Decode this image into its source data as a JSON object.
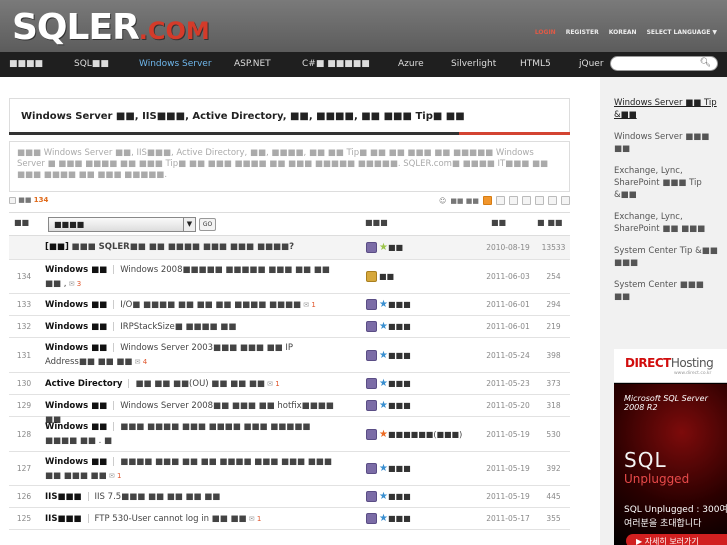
{
  "header": {
    "logo_main": "SQLER",
    "logo_suffix": ".COM",
    "links": [
      "LOGIN",
      "REGISTER",
      "KOREAN",
      "SELECT LANGUAGE ▼"
    ]
  },
  "nav": {
    "items": [
      "■■■■",
      "SQL■■",
      "Windows Server",
      "ASP.NET",
      "C#■ ■■■■■",
      "Azure",
      "Silverlight",
      "HTML5",
      "jQuer"
    ],
    "active_index": 2
  },
  "search": {
    "placeholder": ""
  },
  "page": {
    "title": "Windows Server ■■, IIS■■■, Active Directory, ■■, ■■■■, ■■ ■■■ Tip■ ■■",
    "description_1": "■■■ Windows Server ■■, IIS■■■, Active Directory, ■■, ■■■■, ■■ ■■ Tip■ ■■ ■■ ■■■ ■■ ■■■■■",
    "description_2": "Windows Server ■ ■■■ ■■■■ ■■ ■■■ Tip■ ■■ ■■■ ■■■■ ■■ ■■■ ■■■■■ ■■■■■. SQLER.com■ ■■■■",
    "description_3": "IT■■■ ■■ ■■■ ■■■■ ■■ ■■■ ■■■■■."
  },
  "toolbar": {
    "count_label": "■■",
    "count": "134",
    "user_label": "■■ ■■"
  },
  "table": {
    "headers": {
      "num": "■■",
      "author": "■■■",
      "date": "■■",
      "views": "■ ■■"
    },
    "category_select": "■■■■",
    "go_label": "GO",
    "rows": [
      {
        "num": "",
        "category": "[■■]",
        "text": "■■■ SQLER■■ ■■ ■■■■ ■■■ ■■■ ■■■■?",
        "comments": "",
        "author": "■■",
        "date": "2010-08-19",
        "views": "13533",
        "notice": true
      },
      {
        "num": "134",
        "category": "Windows ■■",
        "text": "Windows 2008■■■■■ ■■■■■ ■■■ ■■ ■■ ■■ ,",
        "comments": "3",
        "author": "■■",
        "date": "2011-06-03",
        "views": "254"
      },
      {
        "num": "133",
        "category": "Windows ■■",
        "text": "I/O■ ■■■■ ■■ ■■ ■■ ■■■■ ■■■■",
        "comments": "1",
        "author": "■■■",
        "date": "2011-06-01",
        "views": "294"
      },
      {
        "num": "132",
        "category": "Windows ■■",
        "text": "IRPStackSize■ ■■■■ ■■",
        "comments": "",
        "author": "■■■",
        "date": "2011-06-01",
        "views": "219"
      },
      {
        "num": "131",
        "category": "Windows ■■",
        "text": "Windows Server 2003■■■ ■■■ ■■ IP Address■■ ■■ ■■",
        "comments": "4",
        "author": "■■■",
        "date": "2011-05-24",
        "views": "398"
      },
      {
        "num": "130",
        "category": "Active Directory",
        "text": "■■ ■■ ■■(OU) ■■ ■■ ■■",
        "comments": "1",
        "author": "■■■",
        "date": "2011-05-23",
        "views": "373"
      },
      {
        "num": "129",
        "category": "Windows ■■",
        "text": "Windows Server 2008■■ ■■■ ■■ hotfix■■■■ ■■",
        "comments": "",
        "author": "■■■",
        "date": "2011-05-20",
        "views": "318"
      },
      {
        "num": "128",
        "category": "Windows ■■",
        "text": "■■■ ■■■■ ■■■ ■■■■ ■■■ ■■■■■ ■■■■ ■■ . ■",
        "comments": "",
        "author": "■■■■■■(■■■)",
        "date": "2011-05-19",
        "views": "530"
      },
      {
        "num": "127",
        "category": "Windows ■■",
        "text": "■■■■ ■■■ ■■ ■■ ■■■■ ■■■ ■■■ ■■■ ■■ ■■■ ■■",
        "comments": "1",
        "author": "■■■",
        "date": "2011-05-19",
        "views": "392"
      },
      {
        "num": "126",
        "category": "IIS■■■",
        "text": "IIS 7.5■■■ ■■ ■■ ■■ ■■",
        "comments": "",
        "author": "■■■",
        "date": "2011-05-19",
        "views": "445"
      },
      {
        "num": "125",
        "category": "IIS■■■",
        "text": "FTP 530-User cannot log in ■■ ■■",
        "comments": "1",
        "author": "■■■",
        "date": "2011-05-17",
        "views": "355"
      }
    ]
  },
  "sidebar": {
    "links": [
      "Windows Server ■■ Tip &■■",
      "Windows Server ■■■ ■■",
      "Exchange, Lync, SharePoint ■■■ Tip &■■",
      "Exchange, Lync, SharePoint ■■ ■■■",
      "System Center Tip &■■ ■■■",
      "System Center ■■■ ■■"
    ]
  },
  "ad": {
    "brand": "DIRECT",
    "brand_suffix": "Hosting",
    "brand_sub": "www.direct.co.kr",
    "product": "Microsoft SQL Server 2008 R2",
    "big": "SQL",
    "unplugged": "Unplugged",
    "line1": "SQL Unplugged : 300여",
    "line2": "여러분을 초대합니다",
    "button": "▶ 자세히 보러가기"
  }
}
